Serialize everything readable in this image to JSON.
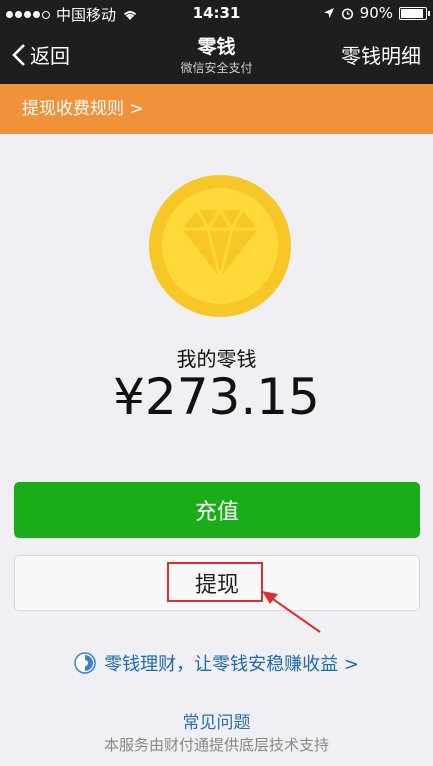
{
  "status_bar": {
    "carrier": "中国移动",
    "time": "14:31",
    "battery_percent": "90%",
    "battery_level": 0.9
  },
  "nav": {
    "back_label": "返回",
    "title": "零钱",
    "subtitle": "微信安全支付",
    "right_label": "零钱明细"
  },
  "banner": {
    "text": "提现收费规则 >"
  },
  "wallet": {
    "label": "我的零钱",
    "balance": "¥273.15"
  },
  "actions": {
    "recharge_label": "充值",
    "withdraw_label": "提现"
  },
  "links": {
    "invest_label": "零钱理财，让零钱安稳赚收益 >",
    "faq_label": "常见问题",
    "footer_text": "本服务由财付通提供底层技术支持"
  },
  "colors": {
    "nav_bg": "#1e1e20",
    "banner": "#f0923a",
    "recharge_green": "#1aad19",
    "highlight_red": "#d9312d",
    "coin_yellow": "#f7c627"
  }
}
